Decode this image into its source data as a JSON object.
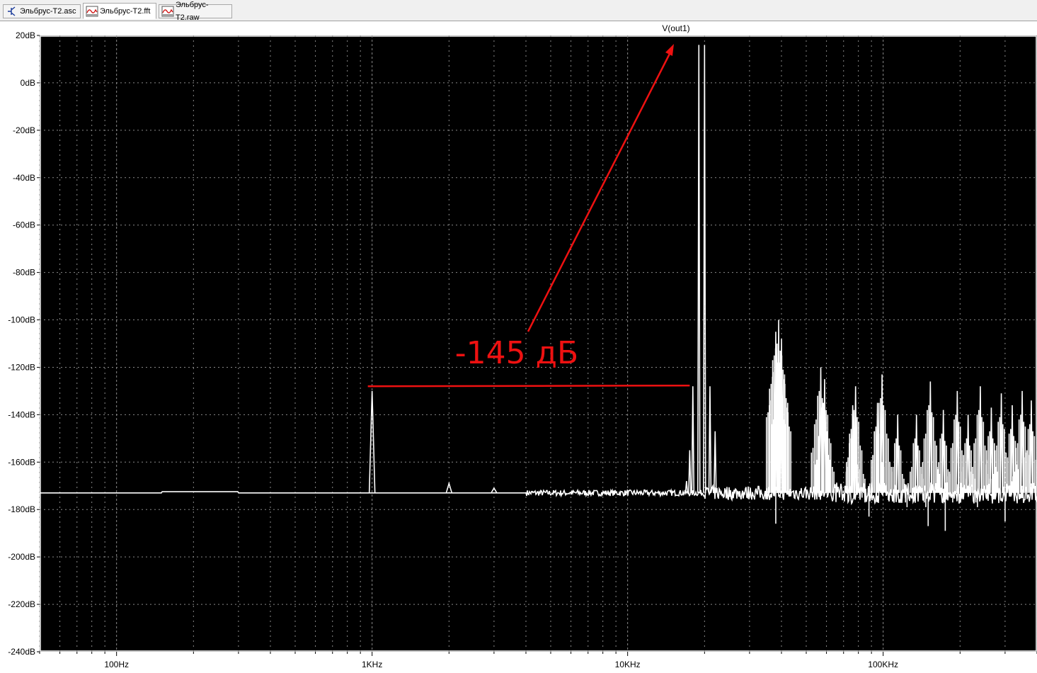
{
  "tabs": [
    {
      "label": "Эльбрус-T2.asc",
      "icon": "schematic-icon",
      "active": false
    },
    {
      "label": "Эльбрус-T2.fft",
      "icon": "waveform-icon",
      "active": true
    },
    {
      "label": "Эльбрус-T2.raw",
      "icon": "waveform-icon",
      "active": false
    }
  ],
  "colors": {
    "background": "#000000",
    "trace": "#ffffff",
    "grid": "#8a8a8a",
    "annotation": "#ee1111"
  },
  "annotation": {
    "text": "-145 дБ",
    "level_db": -128,
    "from_freq_hz": 1000,
    "to_freq_hz": 17500
  },
  "chart_data": {
    "type": "line",
    "title": "V(out1)",
    "xlabel": "",
    "ylabel": "",
    "x_scale": "log",
    "xlim": [
      50,
      400000
    ],
    "ylim": [
      -240,
      20
    ],
    "grid": true,
    "yticks": [
      "20dB",
      "0dB",
      "-20dB",
      "-40dB",
      "-60dB",
      "-80dB",
      "-100dB",
      "-120dB",
      "-140dB",
      "-160dB",
      "-180dB",
      "-200dB",
      "-220dB",
      "-240dB"
    ],
    "xticks": [
      "100Hz",
      "1KHz",
      "10KHz",
      "100KHz"
    ],
    "series": [
      {
        "name": "V(out1)",
        "noise_floor_db": -173,
        "peaks": [
          {
            "freq_hz": 1000,
            "db": -130
          },
          {
            "freq_hz": 2000,
            "db": -169
          },
          {
            "freq_hz": 3000,
            "db": -171
          },
          {
            "freq_hz": 17000,
            "db": -168
          },
          {
            "freq_hz": 17500,
            "db": -155
          },
          {
            "freq_hz": 18000,
            "db": -128
          },
          {
            "freq_hz": 19000,
            "db": 16
          },
          {
            "freq_hz": 20000,
            "db": 16
          },
          {
            "freq_hz": 21000,
            "db": -128
          },
          {
            "freq_hz": 22000,
            "db": -147
          },
          {
            "freq_hz": 38000,
            "db": -105
          },
          {
            "freq_hz": 39000,
            "db": -100
          },
          {
            "freq_hz": 40000,
            "db": -108
          },
          {
            "freq_hz": 57000,
            "db": -120
          },
          {
            "freq_hz": 59000,
            "db": -125
          },
          {
            "freq_hz": 76000,
            "db": -136
          },
          {
            "freq_hz": 78000,
            "db": -128
          },
          {
            "freq_hz": 95000,
            "db": -135
          },
          {
            "freq_hz": 99000,
            "db": -123
          },
          {
            "freq_hz": 114000,
            "db": -140
          },
          {
            "freq_hz": 135000,
            "db": -140
          },
          {
            "freq_hz": 153000,
            "db": -126
          },
          {
            "freq_hz": 172000,
            "db": -138
          },
          {
            "freq_hz": 195000,
            "db": -130
          },
          {
            "freq_hz": 215000,
            "db": -140
          },
          {
            "freq_hz": 240000,
            "db": -128
          },
          {
            "freq_hz": 265000,
            "db": -137
          },
          {
            "freq_hz": 290000,
            "db": -131
          },
          {
            "freq_hz": 320000,
            "db": -136
          },
          {
            "freq_hz": 350000,
            "db": -130
          },
          {
            "freq_hz": 380000,
            "db": -134
          }
        ],
        "dips": [
          {
            "freq_hz": 38000,
            "db": -186
          },
          {
            "freq_hz": 88000,
            "db": -183
          },
          {
            "freq_hz": 150000,
            "db": -187
          },
          {
            "freq_hz": 175000,
            "db": -189
          },
          {
            "freq_hz": 300000,
            "db": -185
          }
        ]
      }
    ]
  }
}
